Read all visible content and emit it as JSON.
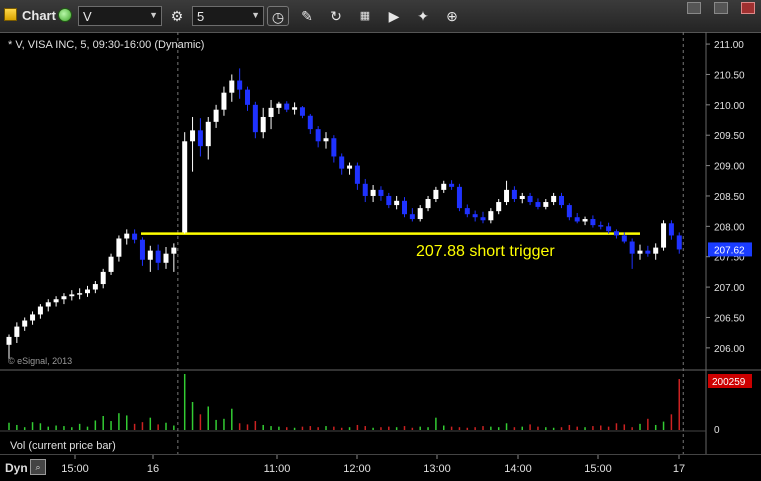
{
  "toolbar": {
    "title": "Chart",
    "symbol": "V",
    "interval": "5",
    "icons": [
      "chart-app-icon",
      "link-icon",
      "settings-icon",
      "clock-icon",
      "pencil-icon",
      "refresh-icon",
      "chart-type-icon",
      "play-icon",
      "tools-icon"
    ]
  },
  "colors": {
    "up": "#ffffff",
    "down": "#1f32ff",
    "trigger": "#ffff00",
    "vol_up": "#33cc33",
    "vol_down": "#cc2222",
    "price_badge": "#1a3cff",
    "vol_badge": "#cc0000"
  },
  "chart_data": {
    "type": "candlestick",
    "header": "* V, VISA INC, 5, 09:30-16:00 (Dynamic)",
    "watermark": "© eSignal, 2013",
    "price_axis": {
      "min": 205.8,
      "max": 211.1,
      "ticks": [
        "211.00",
        "210.50",
        "210.00",
        "209.50",
        "209.00",
        "208.50",
        "208.00",
        "207.50",
        "207.00",
        "206.50",
        "206.00"
      ]
    },
    "time_axis": {
      "ticks": [
        "15:00",
        "16",
        "11:00",
        "12:00",
        "13:00",
        "14:00",
        "15:00",
        "17"
      ]
    },
    "session_separators": [
      "16",
      "17"
    ],
    "trigger_line": {
      "price": 207.88,
      "label": "207.88 short trigger"
    },
    "last_price": "207.62",
    "ohlc": [
      [
        206.05,
        206.22,
        205.82,
        206.18
      ],
      [
        206.18,
        206.42,
        206.08,
        206.35
      ],
      [
        206.35,
        206.5,
        206.28,
        206.45
      ],
      [
        206.45,
        206.6,
        206.38,
        206.55
      ],
      [
        206.55,
        206.72,
        206.48,
        206.68
      ],
      [
        206.68,
        206.8,
        206.6,
        206.75
      ],
      [
        206.75,
        206.85,
        206.68,
        206.8
      ],
      [
        206.8,
        206.9,
        206.72,
        206.85
      ],
      [
        206.85,
        206.95,
        206.78,
        206.88
      ],
      [
        206.88,
        206.98,
        206.8,
        206.9
      ],
      [
        206.9,
        207.02,
        206.84,
        206.96
      ],
      [
        206.96,
        207.1,
        206.9,
        207.05
      ],
      [
        207.05,
        207.3,
        206.98,
        207.25
      ],
      [
        207.25,
        207.55,
        207.2,
        207.5
      ],
      [
        207.5,
        207.85,
        207.42,
        207.8
      ],
      [
        207.8,
        207.95,
        207.7,
        207.88
      ],
      [
        207.88,
        207.95,
        207.72,
        207.78
      ],
      [
        207.78,
        207.82,
        207.35,
        207.45
      ],
      [
        207.45,
        207.68,
        207.25,
        207.6
      ],
      [
        207.6,
        207.7,
        207.28,
        207.4
      ],
      [
        207.4,
        207.66,
        207.3,
        207.55
      ],
      [
        207.55,
        207.72,
        207.25,
        207.65
      ],
      [
        207.9,
        209.55,
        207.88,
        209.4
      ],
      [
        209.4,
        209.8,
        208.9,
        209.58
      ],
      [
        209.58,
        209.78,
        209.15,
        209.32
      ],
      [
        209.32,
        209.8,
        209.1,
        209.72
      ],
      [
        209.72,
        210.0,
        209.62,
        209.92
      ],
      [
        209.92,
        210.3,
        209.82,
        210.2
      ],
      [
        210.2,
        210.5,
        210.05,
        210.4
      ],
      [
        210.4,
        210.6,
        210.1,
        210.25
      ],
      [
        210.25,
        210.3,
        209.9,
        210.0
      ],
      [
        210.0,
        210.05,
        209.45,
        209.55
      ],
      [
        209.55,
        209.95,
        209.45,
        209.8
      ],
      [
        209.8,
        210.08,
        209.6,
        209.95
      ],
      [
        209.95,
        210.05,
        209.85,
        210.02
      ],
      [
        210.02,
        210.06,
        209.88,
        209.92
      ],
      [
        209.92,
        210.04,
        209.84,
        209.96
      ],
      [
        209.96,
        209.98,
        209.78,
        209.82
      ],
      [
        209.82,
        209.85,
        209.52,
        209.6
      ],
      [
        209.6,
        209.65,
        209.3,
        209.4
      ],
      [
        209.4,
        209.55,
        209.28,
        209.45
      ],
      [
        209.45,
        209.5,
        209.05,
        209.15
      ],
      [
        209.15,
        209.2,
        208.85,
        208.95
      ],
      [
        208.95,
        209.05,
        208.85,
        209.0
      ],
      [
        209.0,
        209.05,
        208.6,
        208.7
      ],
      [
        208.7,
        208.78,
        208.4,
        208.5
      ],
      [
        208.5,
        208.68,
        208.4,
        208.6
      ],
      [
        208.6,
        208.66,
        208.42,
        208.5
      ],
      [
        208.5,
        208.55,
        208.3,
        208.35
      ],
      [
        208.35,
        208.5,
        208.28,
        208.42
      ],
      [
        208.42,
        208.48,
        208.15,
        208.2
      ],
      [
        208.2,
        208.3,
        208.08,
        208.12
      ],
      [
        208.12,
        208.35,
        208.08,
        208.3
      ],
      [
        208.3,
        208.5,
        208.25,
        208.45
      ],
      [
        208.45,
        208.65,
        208.4,
        208.6
      ],
      [
        208.6,
        208.75,
        208.55,
        208.7
      ],
      [
        208.7,
        208.76,
        208.6,
        208.65
      ],
      [
        208.65,
        208.7,
        208.25,
        208.3
      ],
      [
        208.3,
        208.36,
        208.15,
        208.2
      ],
      [
        208.2,
        208.26,
        208.08,
        208.15
      ],
      [
        208.15,
        208.24,
        208.05,
        208.1
      ],
      [
        208.1,
        208.3,
        208.05,
        208.25
      ],
      [
        208.25,
        208.45,
        208.2,
        208.4
      ],
      [
        208.4,
        208.75,
        208.35,
        208.6
      ],
      [
        208.6,
        208.66,
        208.4,
        208.45
      ],
      [
        208.45,
        208.55,
        208.38,
        208.5
      ],
      [
        208.5,
        208.55,
        208.35,
        208.4
      ],
      [
        208.4,
        208.46,
        208.28,
        208.32
      ],
      [
        208.32,
        208.45,
        208.28,
        208.4
      ],
      [
        208.4,
        208.55,
        208.35,
        208.5
      ],
      [
        208.5,
        208.55,
        208.3,
        208.35
      ],
      [
        208.35,
        208.38,
        208.1,
        208.15
      ],
      [
        208.15,
        208.22,
        208.05,
        208.08
      ],
      [
        208.08,
        208.16,
        208.02,
        208.12
      ],
      [
        208.12,
        208.18,
        207.98,
        208.02
      ],
      [
        208.02,
        208.08,
        207.95,
        208.0
      ],
      [
        208.0,
        208.06,
        207.88,
        207.92
      ],
      [
        207.92,
        207.95,
        207.8,
        207.85
      ],
      [
        207.85,
        207.9,
        207.72,
        207.75
      ],
      [
        207.75,
        207.8,
        207.3,
        207.55
      ],
      [
        207.55,
        207.7,
        207.45,
        207.6
      ],
      [
        207.6,
        207.68,
        207.5,
        207.55
      ],
      [
        207.55,
        207.72,
        207.45,
        207.65
      ],
      [
        207.65,
        208.1,
        207.6,
        208.05
      ],
      [
        208.05,
        208.1,
        207.78,
        207.85
      ],
      [
        207.85,
        207.9,
        207.55,
        207.62
      ]
    ],
    "volume": {
      "label": "Vol (current price bar)",
      "last": "200259",
      "axis_tick": "0",
      "values": [
        0.13,
        0.09,
        0.05,
        0.14,
        0.12,
        0.06,
        0.08,
        0.07,
        0.05,
        0.11,
        0.06,
        0.17,
        0.25,
        0.16,
        0.3,
        0.26,
        0.11,
        0.14,
        0.22,
        0.1,
        0.13,
        0.08,
        1.0,
        0.5,
        0.28,
        0.42,
        0.18,
        0.2,
        0.38,
        0.12,
        0.1,
        0.16,
        0.09,
        0.07,
        0.06,
        0.05,
        0.04,
        0.06,
        0.07,
        0.05,
        0.07,
        0.06,
        0.04,
        0.05,
        0.09,
        0.07,
        0.04,
        0.05,
        0.06,
        0.05,
        0.07,
        0.04,
        0.06,
        0.05,
        0.22,
        0.08,
        0.06,
        0.05,
        0.04,
        0.05,
        0.07,
        0.06,
        0.05,
        0.12,
        0.05,
        0.06,
        0.1,
        0.06,
        0.05,
        0.04,
        0.05,
        0.09,
        0.06,
        0.05,
        0.07,
        0.08,
        0.06,
        0.12,
        0.1,
        0.05,
        0.11,
        0.2,
        0.09,
        0.15,
        0.28,
        0.91
      ]
    }
  }
}
